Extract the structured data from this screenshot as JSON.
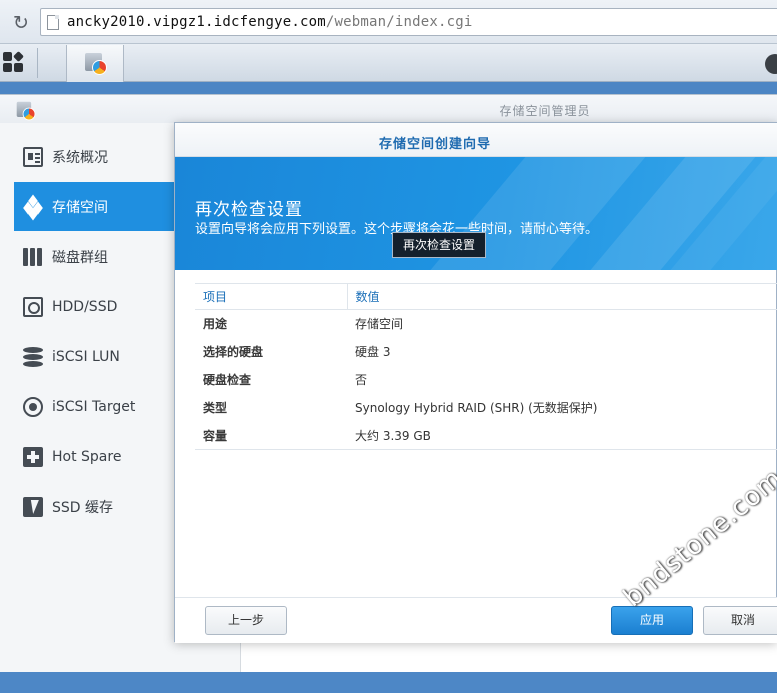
{
  "browser": {
    "url_host": "ancky2010.vipgz1.idcfengye.com",
    "url_path": "/webman/index.cgi"
  },
  "app": {
    "title": "存储空间管理员"
  },
  "sidebar": {
    "items": [
      {
        "label": "系统概况",
        "icon": "overview-icon"
      },
      {
        "label": "存储空间",
        "icon": "cubes-icon",
        "active": true
      },
      {
        "label": "磁盘群组",
        "icon": "raid-group-icon"
      },
      {
        "label": "HDD/SSD",
        "icon": "hard-disk-icon"
      },
      {
        "label": "iSCSI LUN",
        "icon": "database-icon"
      },
      {
        "label": "iSCSI Target",
        "icon": "target-icon"
      },
      {
        "label": "Hot Spare",
        "icon": "plus-box-icon"
      },
      {
        "label": "SSD 缓存",
        "icon": "lightning-icon"
      }
    ]
  },
  "wizard": {
    "title": "存储空间创建向导",
    "step_title": "再次检查设置",
    "step_desc": "设置向导将会应用下列设置。这个步骤将会花一些时间，请耐心等待。",
    "tooltip": "再次检查设置",
    "table": {
      "headers": [
        "项目",
        "数值"
      ],
      "rows": [
        {
          "item": "用途",
          "value": "存储空间"
        },
        {
          "item": "选择的硬盘",
          "value": "硬盘 3"
        },
        {
          "item": "硬盘检查",
          "value": "否"
        },
        {
          "item": "类型",
          "value": "Synology Hybrid RAID (SHR) (无数据保护)"
        },
        {
          "item": "容量",
          "value": "大约 3.39 GB"
        }
      ]
    },
    "buttons": {
      "prev": "上一步",
      "apply": "应用",
      "cancel": "取消"
    }
  },
  "watermark": "bndstone.com",
  "colors": {
    "accent": "#1f8fe0",
    "header_blue": "#1a86d8",
    "desktop_blue": "#4c85c4"
  }
}
